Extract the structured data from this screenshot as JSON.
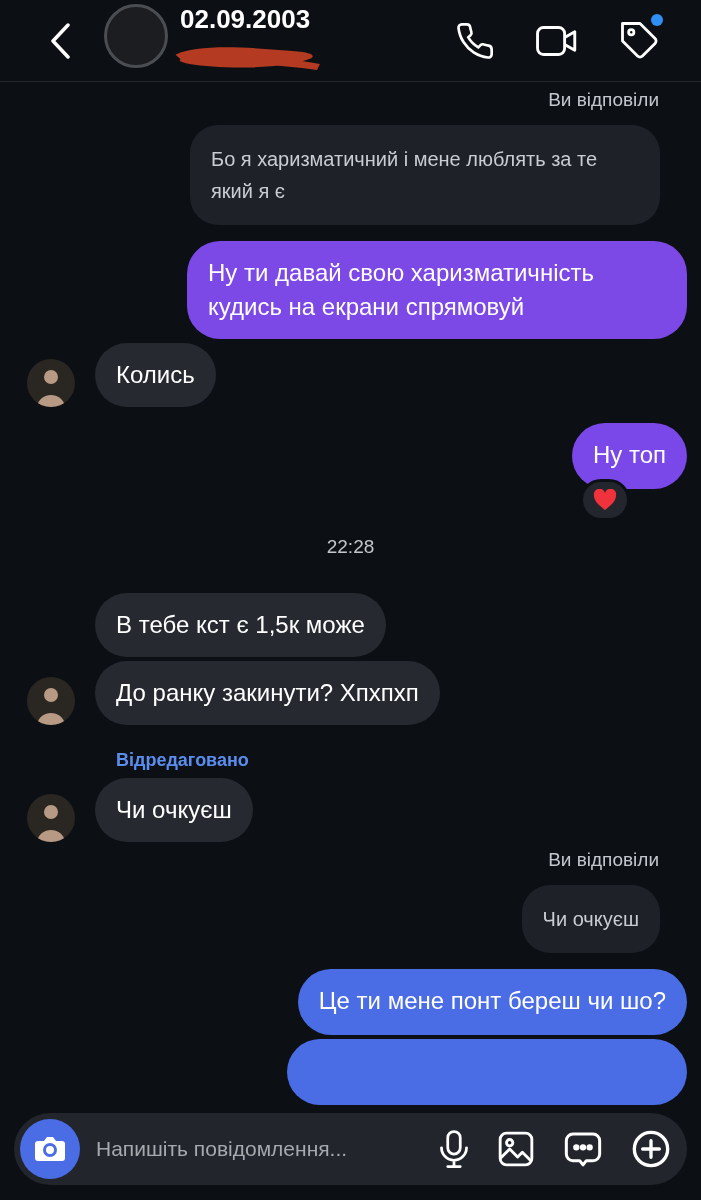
{
  "header": {
    "title": "02.09.2003",
    "tag_badge": true
  },
  "messages": [
    {
      "kind": "reply_label",
      "text": "Ви відповіли"
    },
    {
      "kind": "quoted",
      "text": "Бо я харизматичний і мене люблять за те який я є"
    },
    {
      "kind": "out",
      "text": "Ну ти давай свою харизматичність кудись на екрани спрямовуй",
      "color": "#7c48e6"
    },
    {
      "kind": "in",
      "text": "Колись",
      "avatar": true
    },
    {
      "kind": "out",
      "text": "Ну топ",
      "color": "#7a47e8",
      "reaction": true
    },
    {
      "kind": "time",
      "text": "22:28"
    },
    {
      "kind": "in",
      "text": "В тебе кст є 1,5к може",
      "avatar": false
    },
    {
      "kind": "in",
      "text": "До ранку закинути? Хпхпхп",
      "avatar": true
    },
    {
      "kind": "edited_label",
      "text": "Відредаговано"
    },
    {
      "kind": "in",
      "text": "Чи очкуєш",
      "avatar": true
    },
    {
      "kind": "reply_label",
      "text": "Ви відповіли"
    },
    {
      "kind": "quoted",
      "text": "Чи очкуєш"
    },
    {
      "kind": "out",
      "text": "Це ти мене понт береш чи шо?",
      "color": "#4a6de5"
    },
    {
      "kind": "out",
      "color": "#4a6de5"
    }
  ],
  "composer": {
    "placeholder": "Напишіть повідомлення..."
  }
}
